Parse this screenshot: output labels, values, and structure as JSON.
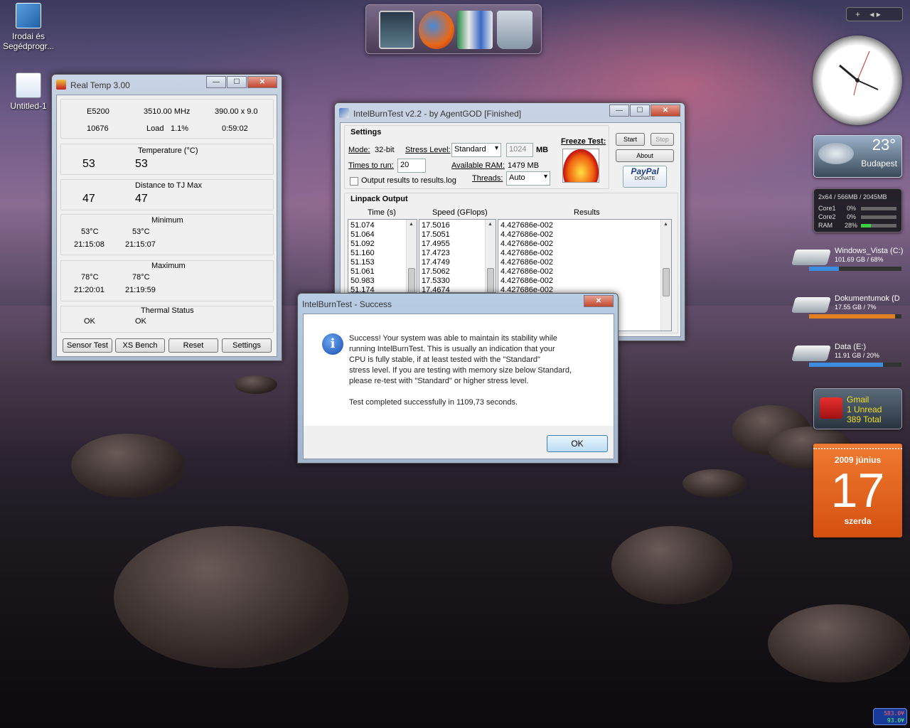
{
  "desktop": {
    "icons": [
      {
        "label": "Irodai és Segédprogr..."
      },
      {
        "label": "Untitled-1"
      }
    ]
  },
  "dock": {
    "items": [
      {
        "name": "monitor"
      },
      {
        "name": "firefox"
      },
      {
        "name": "books"
      },
      {
        "name": "recycle-bin"
      }
    ]
  },
  "realtemp": {
    "title": "Real Temp 3.00",
    "cpu": "E5200",
    "mhz": "3510.00 MHz",
    "multiplier": "390.00 x 9.0",
    "vid": "10676",
    "load_label": "Load",
    "load": "1.1%",
    "time": "0:59:02",
    "temp_label": "Temperature (°C)",
    "temp": [
      "53",
      "53"
    ],
    "dist_label": "Distance to TJ Max",
    "dist": [
      "47",
      "47"
    ],
    "min_label": "Minimum",
    "min_temp": [
      "53°C",
      "53°C"
    ],
    "min_time": [
      "21:15:08",
      "21:15:07"
    ],
    "max_label": "Maximum",
    "max_temp": [
      "78°C",
      "78°C"
    ],
    "max_time": [
      "21:20:01",
      "21:19:59"
    ],
    "status_label": "Thermal Status",
    "status": [
      "OK",
      "OK"
    ],
    "buttons": [
      "Sensor Test",
      "XS Bench",
      "Reset",
      "Settings"
    ]
  },
  "ibt": {
    "title": "IntelBurnTest v2.2 - by AgentGOD [Finished]",
    "settings_label": "Settings",
    "mode_label": "Mode:",
    "mode": "32-bit",
    "stress_label": "Stress Level:",
    "stress": "Standard",
    "mem": "1024",
    "mb": "MB",
    "times_label": "Times to run:",
    "times": "20",
    "avail_label": "Available RAM:",
    "avail": "1479 MB",
    "output_label": "Output results to results.log",
    "threads_label": "Threads:",
    "threads": "Auto",
    "freeze_label": "Freeze Test:",
    "start": "Start",
    "stop": "Stop",
    "about": "About",
    "paypal": "PayPal",
    "donate": "DONATE",
    "linpack_label": "Linpack Output",
    "col_time": "Time (s)",
    "col_speed": "Speed (GFlops)",
    "col_results": "Results",
    "times_list": [
      "51.074",
      "51.064",
      "51.092",
      "51.160",
      "51.153",
      "51.061",
      "50.983",
      "51.174"
    ],
    "speed_list": [
      "17.5016",
      "17.5051",
      "17.4955",
      "17.4723",
      "17.4749",
      "17.5062",
      "17.5330",
      "17.4674"
    ],
    "results_list": [
      "4.427686e-002",
      "4.427686e-002",
      "4.427686e-002",
      "4.427686e-002",
      "4.427686e-002",
      "4.427686e-002",
      "4.427686e-002",
      "4.427686e-002"
    ]
  },
  "dialog": {
    "title": "IntelBurnTest - Success",
    "lines": [
      "Success! Your system was able to maintain its stability while",
      "running IntelBurnTest. This is usually an indication that your",
      "CPU is fully stable, if at least tested with the \"Standard\"",
      "stress level. If you are testing with memory size below Standard,",
      "please re-test with \"Standard\" or higher stress level."
    ],
    "completed": "Test completed successfully in 1109,73 seconds.",
    "ok": "OK"
  },
  "gadgets": {
    "weather": {
      "temp": "23°",
      "city": "Budapest"
    },
    "cpu": {
      "header": "2x64 / 566MB / 2045MB",
      "rows": [
        {
          "label": "Core1",
          "value": "0%"
        },
        {
          "label": "Core2",
          "value": "0%"
        },
        {
          "label": "RAM",
          "value": "28%"
        }
      ],
      "ram_fill": 0.28
    },
    "drives": [
      {
        "name": "Windows_Vista (C:)",
        "info": "101.69 GB / 68%",
        "fill": 0.32
      },
      {
        "name": "Dokumentumok (D",
        "info": "17.55 GB / 7%",
        "fill": 0.93
      },
      {
        "name": "Data (E:)",
        "info": "11.91 GB / 20%",
        "fill": 0.8
      }
    ],
    "gmail": {
      "title": "Gmail",
      "unread": "1 Unread",
      "total": "389 Total"
    },
    "calendar": {
      "month": "2009 június",
      "day": "17",
      "weekday": "szerda"
    },
    "corner": {
      "top": "583.0¥",
      "bottom": "93.0¥"
    }
  },
  "colors": {
    "accent": "#3070c8",
    "calendar": "#e4621a"
  }
}
